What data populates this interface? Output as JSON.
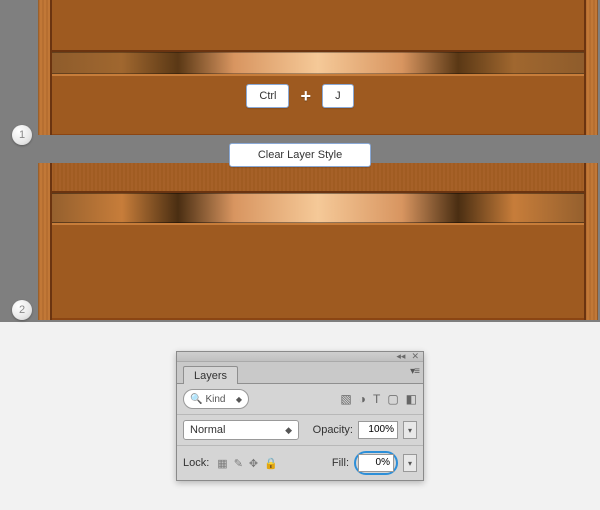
{
  "steps": {
    "one": "1",
    "two": "2"
  },
  "shortcut": {
    "ctrl": "Ctrl",
    "plus": "+",
    "j": "J"
  },
  "action": {
    "clear_layer_style": "Clear Layer Style"
  },
  "panel": {
    "tab": "Layers",
    "filter": {
      "kind_label": "Kind"
    },
    "blend": {
      "mode": "Normal"
    },
    "opacity": {
      "label": "Opacity:",
      "value": "100%"
    },
    "lock": {
      "label": "Lock:"
    },
    "fill": {
      "label": "Fill:",
      "value": "0%"
    }
  }
}
